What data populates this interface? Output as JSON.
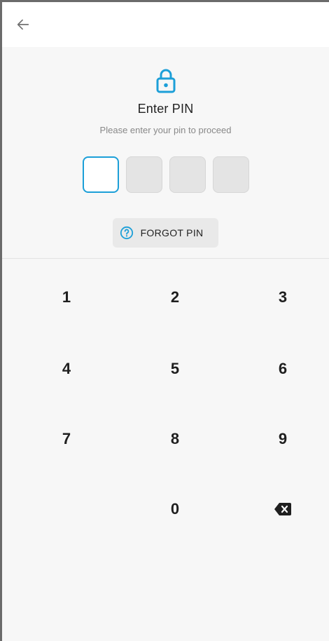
{
  "header": {
    "back_icon": "arrow-left-icon"
  },
  "pin": {
    "lock_icon": "lock-icon",
    "title": "Enter PIN",
    "subtitle": "Please enter your pin to proceed",
    "length": 4,
    "active_index": 0
  },
  "forgot": {
    "icon": "question-circle-icon",
    "label": "FORGOT PIN"
  },
  "keypad": {
    "keys": [
      "1",
      "2",
      "3",
      "4",
      "5",
      "6",
      "7",
      "8",
      "9",
      "0"
    ],
    "backspace_icon": "backspace-icon"
  },
  "colors": {
    "accent": "#1c9fd8",
    "background": "#f7f7f7"
  }
}
